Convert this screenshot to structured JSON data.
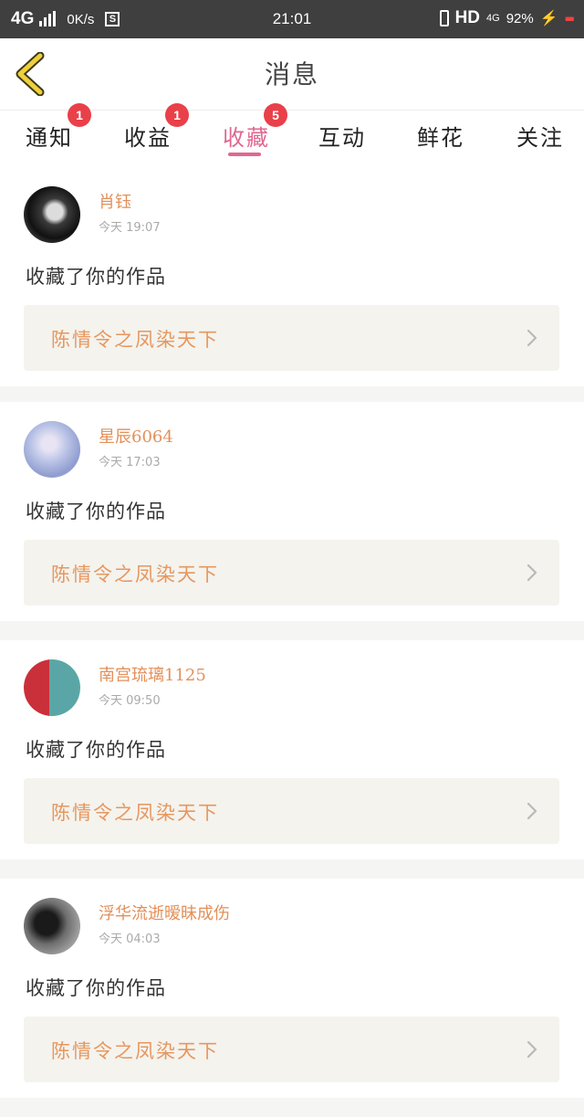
{
  "status_bar": {
    "network": "4G",
    "speed": "0K/s",
    "time": "21:01",
    "hd": "HD",
    "lte": "4G",
    "battery": "92%"
  },
  "nav": {
    "title": "消息",
    "back_icon": "chevron-left-icon",
    "accent": "#e0678f"
  },
  "tabs": [
    {
      "label": "通知",
      "badge": "1"
    },
    {
      "label": "收益",
      "badge": "1"
    },
    {
      "label": "收藏",
      "badge": "5"
    },
    {
      "label": "互动"
    },
    {
      "label": "鲜花"
    },
    {
      "label": "关注"
    }
  ],
  "messages": [
    {
      "name": "肖钰",
      "time": "今天  19:07",
      "action": "收藏了你的作品",
      "work": "陈情令之凤染天下"
    },
    {
      "name": "星辰6064",
      "time": "今天  17:03",
      "action": "收藏了你的作品",
      "work": "陈情令之凤染天下"
    },
    {
      "name": "南宫琉璃1125",
      "time": "今天  09:50",
      "action": "收藏了你的作品",
      "work": "陈情令之凤染天下"
    },
    {
      "name": "浮华流逝暧昧成伤",
      "time": "今天  04:03",
      "action": "收藏了你的作品",
      "work": "陈情令之凤染天下"
    }
  ]
}
